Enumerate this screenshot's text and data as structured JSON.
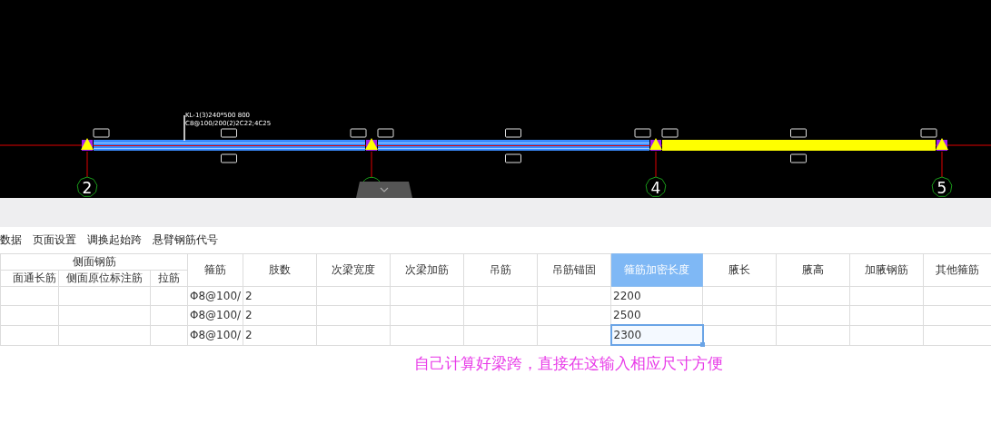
{
  "canvas": {
    "beam_label": [
      "KL-1(3)240*500 800",
      "C8@100/200(2)2C22;4C25"
    ],
    "spans": [
      {
        "selected": false
      },
      {
        "selected": false
      },
      {
        "selected": true
      }
    ],
    "axes": [
      {
        "label": "2",
        "covered": false
      },
      {
        "covered": true
      },
      {
        "label": "4",
        "covered": false
      },
      {
        "label": "5",
        "covered": false
      }
    ]
  },
  "menu": [
    "数据",
    "页面设置",
    "调换起始跨",
    "悬臂钢筋代号"
  ],
  "table": {
    "group": {
      "label": "侧面钢筋",
      "columns": [
        "面通长筋",
        "侧面原位标注筋",
        "拉筋"
      ]
    },
    "columns": [
      {
        "label": "箍筋",
        "selected": false
      },
      {
        "label": "肢数",
        "selected": false
      },
      {
        "label": "次梁宽度",
        "selected": false
      },
      {
        "label": "次梁加筋",
        "selected": false
      },
      {
        "label": "吊筋",
        "selected": false
      },
      {
        "label": "吊筋锚固",
        "selected": false
      },
      {
        "label": "箍筋加密长度",
        "selected": true
      },
      {
        "label": "腋长",
        "selected": false
      },
      {
        "label": "腋高",
        "selected": false
      },
      {
        "label": "加腋钢筋",
        "selected": false
      },
      {
        "label": "其他箍筋",
        "selected": false
      }
    ],
    "rows": [
      {
        "stirrup": "Φ8@100/",
        "legs": "2",
        "dense_length": "2200",
        "focused": false
      },
      {
        "stirrup": "Φ8@100/",
        "legs": "2",
        "dense_length": "2500",
        "focused": false
      },
      {
        "stirrup": "Φ8@100/",
        "legs": "2",
        "dense_length": "2300",
        "focused": true
      }
    ]
  },
  "note": "自己计算好梁跨，直接在这输入相应尺寸方便"
}
